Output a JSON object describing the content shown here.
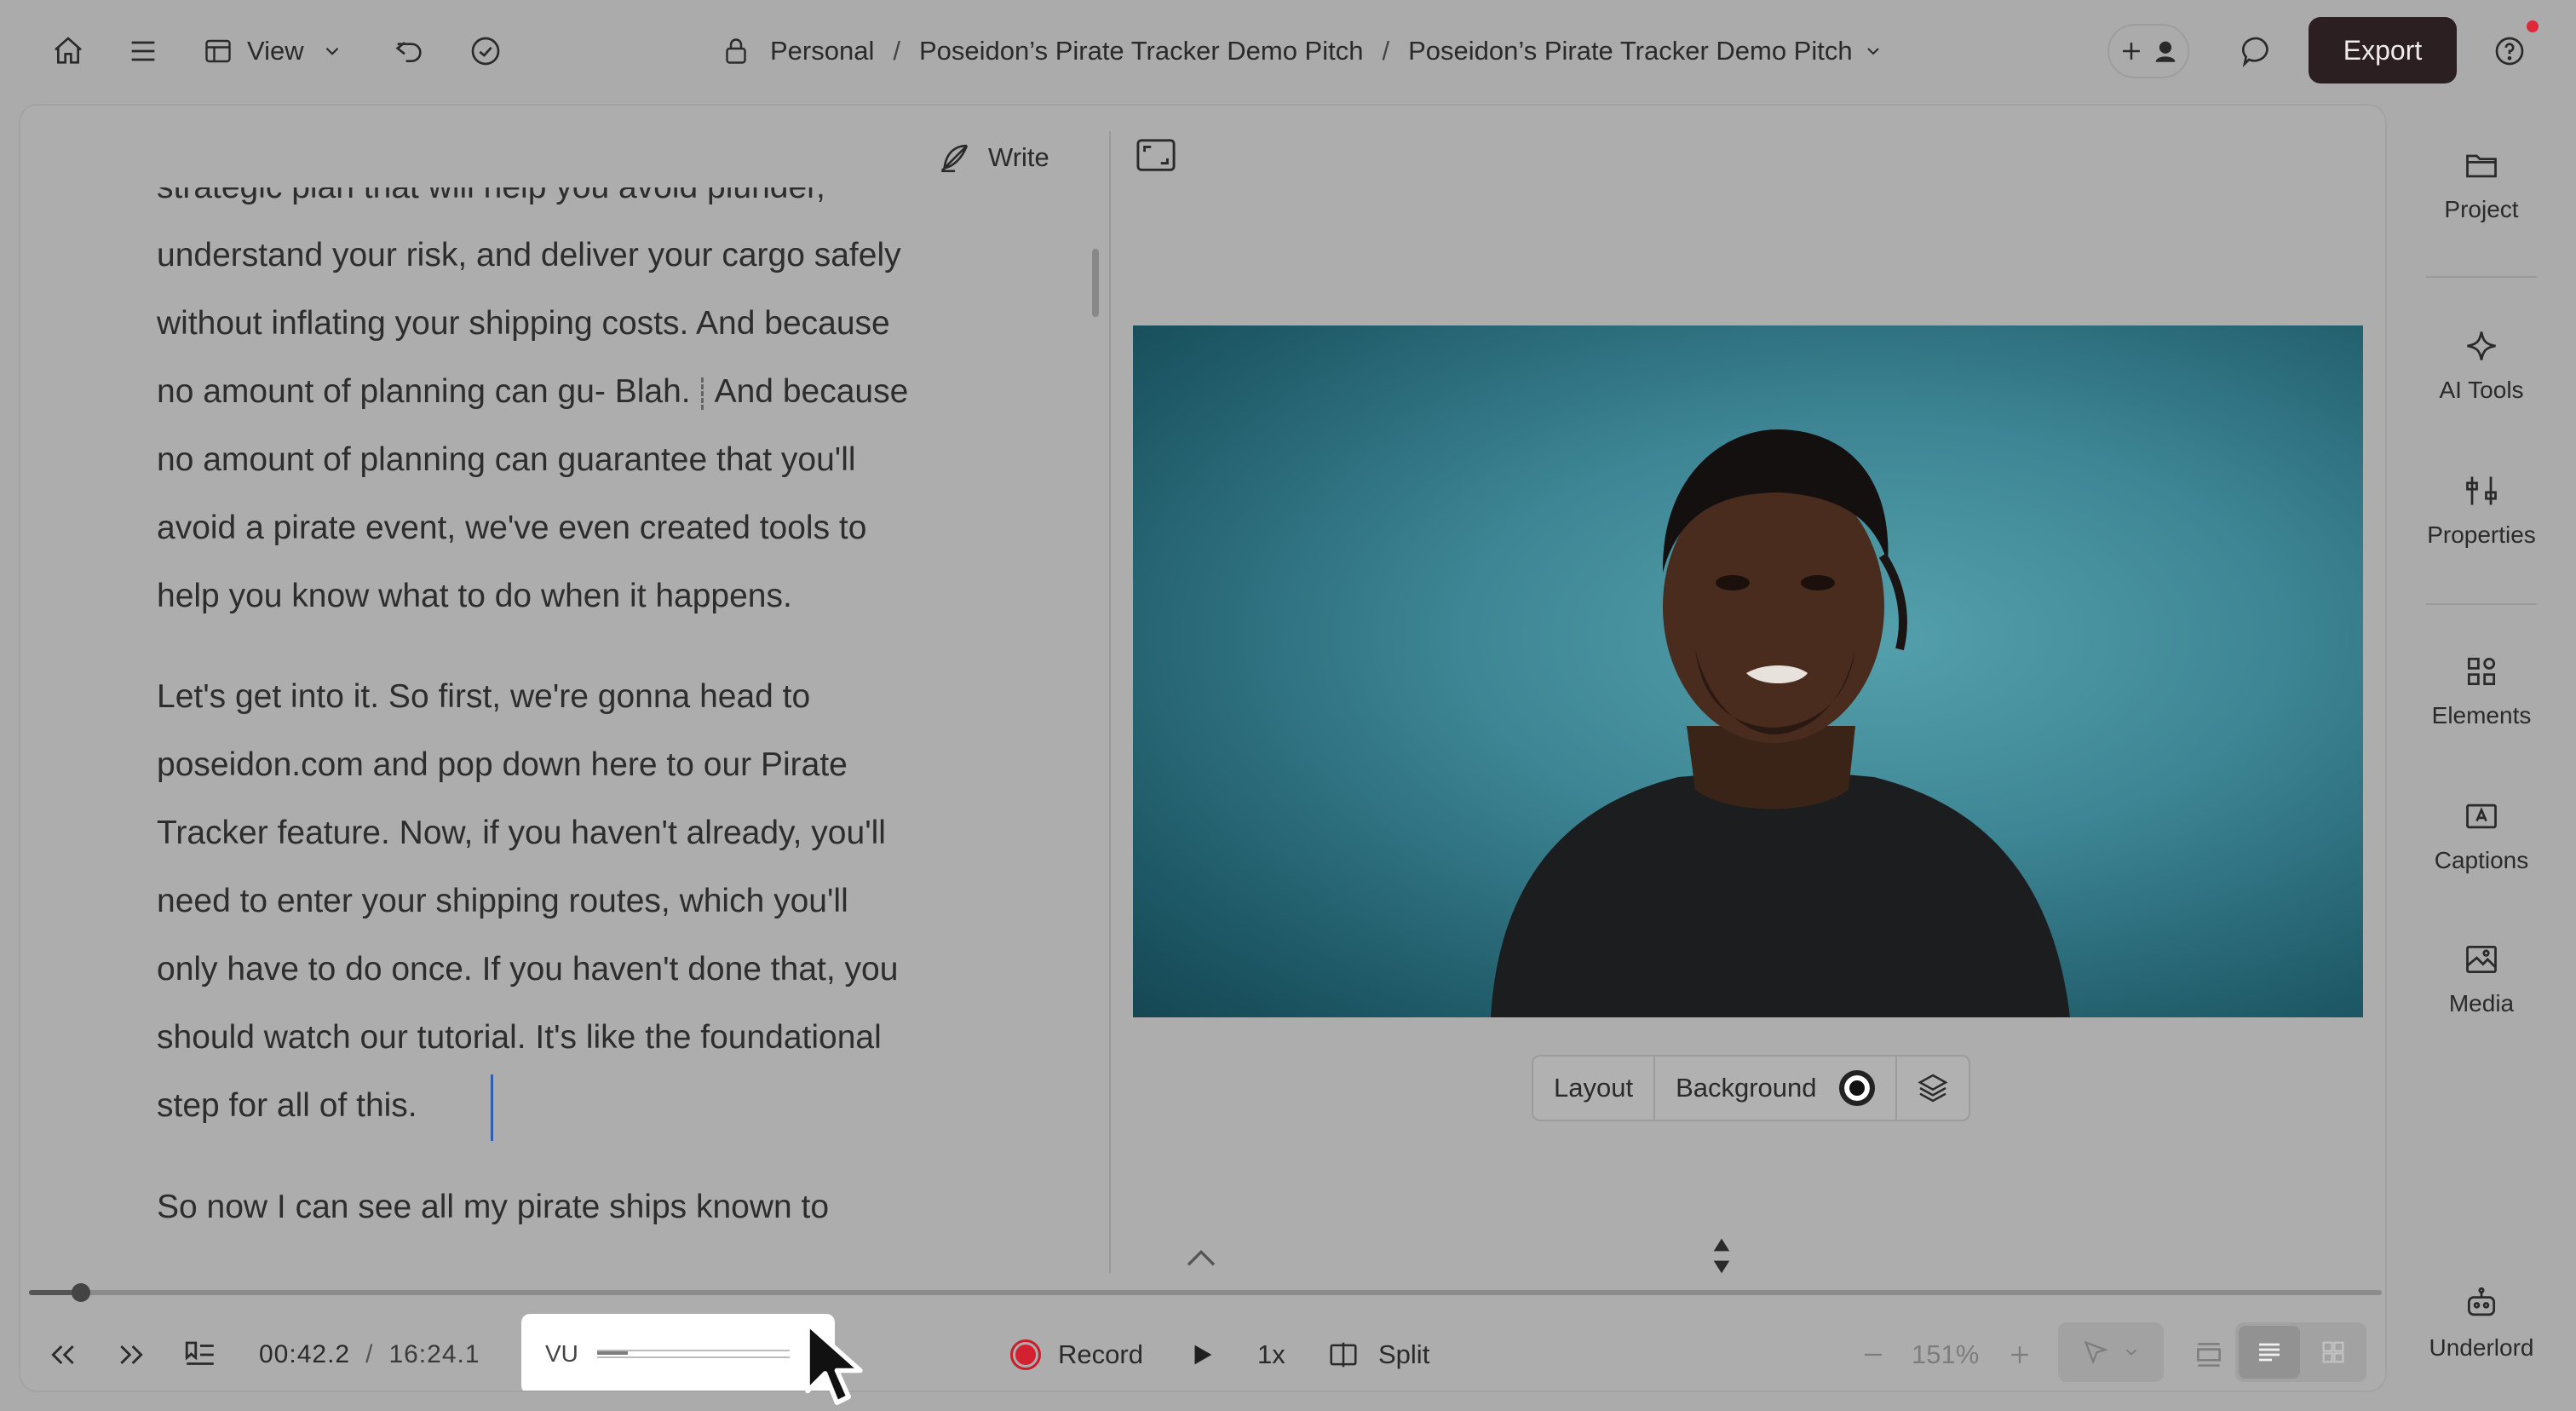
{
  "topbar": {
    "view_label": "View",
    "breadcrumb": [
      "Personal",
      "Poseidon’s Pirate Tracker Demo Pitch",
      "Poseidon’s Pirate Tracker Demo Pitch"
    ],
    "export_label": "Export",
    "notification_color": "#e0283a"
  },
  "editor": {
    "write_label": "Write",
    "paragraphs": [
      {
        "lines": [
          "strategic plan that will help you avoid plunder,",
          "understand your risk, and deliver your cargo safely",
          "without inflating your shipping costs. And because"
        ],
        "cut_before": "no amount of planning can gu- Blah.",
        "cut_after": "And because",
        "tail": [
          "no amount of planning can guarantee that you'll",
          "avoid a pirate event, we've even created tools to",
          "help you know what to do when it happens."
        ]
      },
      {
        "lines": [
          "Let's get into it. So first, we're gonna head to",
          "poseidon.com and pop down here to our Pirate",
          "Tracker feature. Now, if you haven't already, you'll",
          "need to enter your shipping routes, which you'll",
          "only have to do once. If you haven't done that, you",
          "should watch our tutorial. It's like the foundational",
          "step for all of this."
        ]
      },
      {
        "lines": [
          "So now I can see all my pirate ships known to"
        ]
      }
    ]
  },
  "canvas": {
    "layout_label": "Layout",
    "background_label": "Background",
    "background_swatch": "#111111"
  },
  "playback": {
    "current_time": "00:42.2",
    "separator": "/",
    "duration": "16:24.1",
    "timeline_progress": 0.022,
    "vu_label": "VU",
    "vu_level": 0.16,
    "record_label": "Record",
    "speed_label": "1x",
    "split_label": "Split",
    "zoom_level": "151%"
  },
  "sidebar": {
    "items": [
      {
        "label": "Project",
        "icon": "folder-icon"
      },
      {
        "label": "AI Tools",
        "icon": "sparkle-icon"
      },
      {
        "label": "Properties",
        "icon": "sliders-icon"
      },
      {
        "label": "Elements",
        "icon": "shapes-icon"
      },
      {
        "label": "Captions",
        "icon": "caption-icon"
      },
      {
        "label": "Media",
        "icon": "media-icon"
      },
      {
        "label": "Underlord",
        "icon": "robot-icon"
      }
    ]
  }
}
